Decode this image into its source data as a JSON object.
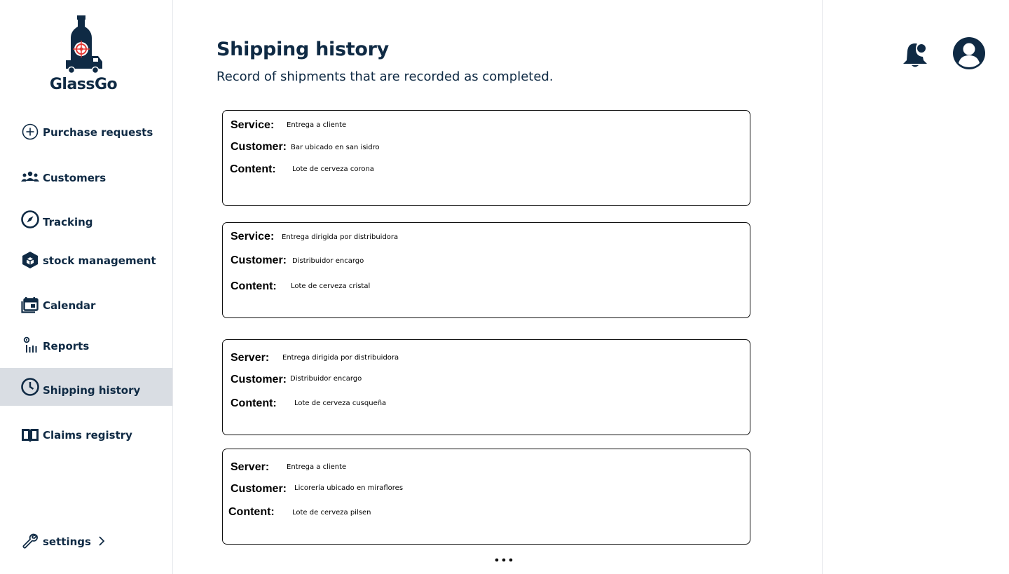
{
  "brand": {
    "name": "GlassGo"
  },
  "sidebar": {
    "items": [
      {
        "label": "Purchase requests",
        "icon": "plus-circle-icon"
      },
      {
        "label": "Customers",
        "icon": "people-icon"
      },
      {
        "label": "Tracking",
        "icon": "compass-icon"
      },
      {
        "label": "stock management",
        "icon": "cube-icon"
      },
      {
        "label": "Calendar",
        "icon": "calendar-icon"
      },
      {
        "label": "Reports",
        "icon": "chart-icon"
      },
      {
        "label": "Shipping history",
        "icon": "clock-icon",
        "active": true
      },
      {
        "label": "Claims registry",
        "icon": "book-icon"
      }
    ],
    "settings": {
      "label": "settings",
      "icon": "wrench-icon"
    }
  },
  "page": {
    "title": "Shipping history",
    "subtitle": "Record of shipments that are recorded as completed."
  },
  "shipments": [
    {
      "service_key": "Service:",
      "service": "Entrega a cliente",
      "customer_key": "Customer:",
      "customer": "Bar ubicado en san isidro",
      "content_key": "Content:",
      "content": "Lote de cerveza corona"
    },
    {
      "service_key": "Service:",
      "service": "Entrega dirigida por distribuidora",
      "customer_key": "Customer:",
      "customer": "Distribuidor encargo",
      "content_key": "Content:",
      "content": "Lote de cerveza cristal"
    },
    {
      "service_key": "Server:",
      "service": "Entrega dirigida por distribuidora",
      "customer_key": "Customer:",
      "customer": "Distribuidor encargo",
      "content_key": "Content:",
      "content": "Lote de cerveza cusqueña"
    },
    {
      "service_key": "Server:",
      "service": "Entrega a cliente",
      "customer_key": "Customer:",
      "customer": "Licorería ubicado en miraflores",
      "content_key": "Content:",
      "content": "Lote de cerveza pilsen"
    }
  ],
  "colors": {
    "primary": "#0f2a44",
    "active_bg": "#d9dde3",
    "logo_accent": "#e53935"
  }
}
